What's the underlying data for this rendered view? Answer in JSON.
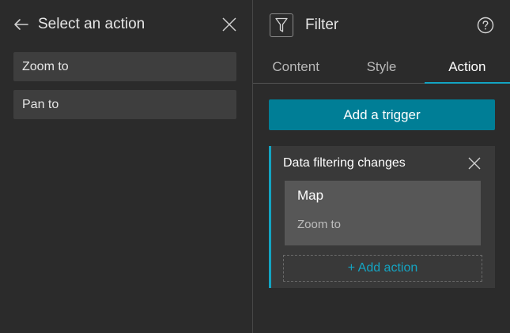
{
  "left_panel": {
    "title": "Select an action",
    "items": [
      {
        "label": "Zoom to"
      },
      {
        "label": "Pan to"
      }
    ]
  },
  "right_panel": {
    "title": "Filter",
    "tabs": [
      {
        "label": "Content",
        "active": false
      },
      {
        "label": "Style",
        "active": false
      },
      {
        "label": "Action",
        "active": true
      }
    ],
    "add_trigger_label": "Add a trigger",
    "trigger": {
      "title": "Data filtering changes",
      "action": {
        "target": "Map",
        "name": "Zoom to"
      },
      "add_action_label": "+ Add action"
    }
  },
  "colors": {
    "background": "#2b2b2b",
    "accent": "#14a4c2",
    "button_primary": "#007e96"
  },
  "icons": [
    "back-arrow-icon",
    "close-icon",
    "filter-icon",
    "help-icon"
  ]
}
